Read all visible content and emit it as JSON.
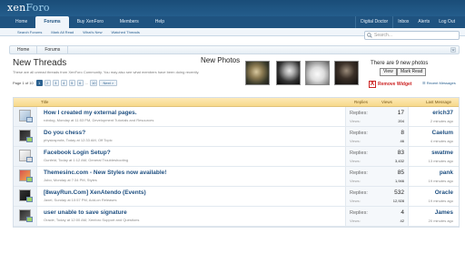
{
  "header": {
    "logo_main": "xen",
    "logo_accent": "Foro"
  },
  "nav": {
    "tabs": [
      {
        "label": "Home"
      },
      {
        "label": "Forums"
      },
      {
        "label": "Buy XenForo"
      },
      {
        "label": "Members"
      },
      {
        "label": "Help"
      }
    ],
    "user": "Digital Doctor",
    "inbox": "Inbox",
    "alerts": "Alerts",
    "logout": "Log Out"
  },
  "subnav": {
    "items": [
      "Search Forums",
      "Mark All Read",
      "What's New",
      "Watched Threads"
    ]
  },
  "search": {
    "placeholder": "Search..."
  },
  "breadcrumb": [
    "Home",
    "Forums"
  ],
  "page": {
    "title": "New Threads",
    "description": "These are all unread threads from XenForo Community. You may also see what members have been doing recently."
  },
  "photos_widget": {
    "title": "New Photos",
    "count_text": "There are 9 new photos",
    "view_label": "View",
    "mark_read_label": "Mark Read",
    "remove_label": "Remove Widget",
    "remove_x": "X"
  },
  "recent_messages": "Recent Messages",
  "pagination": {
    "label": "Page 1 of 10",
    "pages": [
      "1",
      "2",
      "3",
      "4",
      "5",
      "6"
    ],
    "ellipsis": "...",
    "last": "10",
    "next": "Next >"
  },
  "table": {
    "headers": {
      "title": "Title",
      "replies": "Replies",
      "views": "Views",
      "last": "Last Message"
    },
    "replies_label": "Replies:",
    "views_label": "Views:",
    "rows": [
      {
        "title": "How I created my external pages.",
        "meta": "robdog, Monday at 11:53 PM, Development Tutorials and Resources",
        "replies": "17",
        "views": "204",
        "last_user": "erich37",
        "last_time": "2 minutes ago"
      },
      {
        "title": "Do you chess?",
        "meta": "physicsprofa, Today at 12:33 AM, Off Topic",
        "replies": "8",
        "views": "46",
        "last_user": "Caelum",
        "last_time": "4 minutes ago"
      },
      {
        "title": "Facebook Login Setup?",
        "meta": "Gunfeld, Today at 1:12 AM, General Troubleshooting",
        "replies": "83",
        "views": "3,432",
        "last_user": "swatme",
        "last_time": "13 minutes ago"
      },
      {
        "title": "Themesinc.com - New Styles now available!",
        "meta": "Jobo, Monday at 7:34 PM, Styles",
        "replies": "85",
        "views": "1,946",
        "last_user": "pank",
        "last_time": "19 minutes ago"
      },
      {
        "title": "[8wayRun.Com] XenAtendo (Events)",
        "meta": "Jaxel, Sunday at 10:57 PM, Add-on Releases",
        "replies": "532",
        "views": "12,928",
        "last_user": "Oracle",
        "last_time": "19 minutes ago"
      },
      {
        "title": "user unable to save signature",
        "meta": "Oracle, Today at 12:00 AM, Xenforo Support and Questions",
        "replies": "4",
        "views": "42",
        "last_user": "James",
        "last_time": "20 minutes ago"
      }
    ]
  },
  "colors": {
    "header": "#1a4d78",
    "link": "#1e4f80",
    "table_header": "#f7d98b",
    "remove": "#cc2222"
  }
}
